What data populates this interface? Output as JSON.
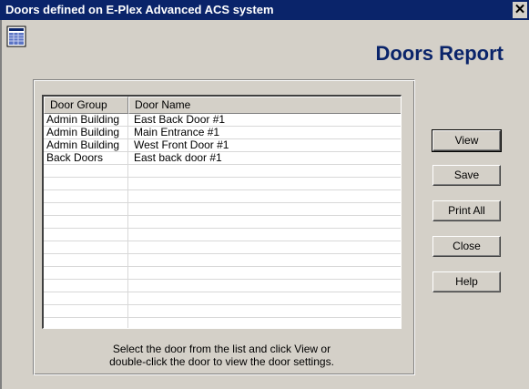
{
  "window": {
    "title": "Doors defined on E-Plex Advanced ACS system",
    "close_glyph": "✕"
  },
  "header": {
    "heading": "Doors Report",
    "icon": "report-document-icon"
  },
  "list": {
    "columns": [
      "Door Group",
      "Door Name"
    ],
    "rows": [
      {
        "group": "Admin Building",
        "name": "East Back Door #1"
      },
      {
        "group": "Admin Building",
        "name": "Main Entrance #1"
      },
      {
        "group": "Admin Building",
        "name": "West Front Door #1"
      },
      {
        "group": "Back Doors",
        "name": "East back door #1"
      }
    ],
    "empty_rows": 13
  },
  "hint": {
    "line1": "Select the door from the list and click View or",
    "line2": "double-click the door to view the door settings."
  },
  "buttons": {
    "view": "View",
    "save": "Save",
    "print_all": "Print All",
    "close": "Close",
    "help": "Help"
  },
  "colors": {
    "titlebar": "#0a246a",
    "heading": "#0a246a",
    "face": "#d4d0c8"
  }
}
